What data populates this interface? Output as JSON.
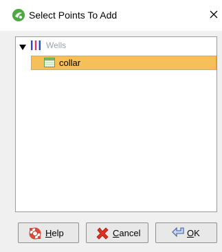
{
  "window": {
    "title": "Select Points To Add",
    "close_icon": "close-icon"
  },
  "tree": {
    "root": {
      "label": "Wells",
      "expanded": true,
      "icon": "wells-icon"
    },
    "children": [
      {
        "label": "collar",
        "selected": true,
        "icon": "table-icon"
      }
    ]
  },
  "buttons": {
    "help": {
      "mnemonic": "H",
      "rest": "elp",
      "icon": "help-lifebuoy-icon"
    },
    "cancel": {
      "mnemonic": "C",
      "rest": "ancel",
      "icon": "cancel-x-icon"
    },
    "ok": {
      "mnemonic": "O",
      "rest": "K",
      "icon": "ok-arrow-icon"
    }
  },
  "colors": {
    "selection_fill": "#f5c05a",
    "selection_border": "#e5a53c",
    "disabled_text": "#9aa3ad",
    "app_icon": "#5bb04d"
  }
}
